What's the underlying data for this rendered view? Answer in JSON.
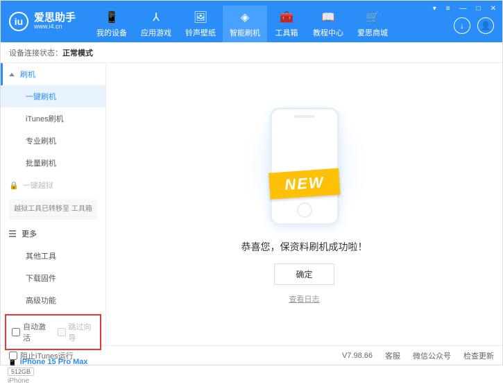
{
  "app": {
    "title": "爱思助手",
    "subtitle": "www.i4.cn"
  },
  "titlebar": {
    "t1": "▾",
    "t2": "≡",
    "t3": "—",
    "t4": "□",
    "t5": "✕"
  },
  "topnav": [
    {
      "label": "我的设备"
    },
    {
      "label": "应用游戏"
    },
    {
      "label": "铃声壁纸"
    },
    {
      "label": "智能刷机"
    },
    {
      "label": "工具箱"
    },
    {
      "label": "教程中心"
    },
    {
      "label": "爱思商城"
    }
  ],
  "status": {
    "prefix": "设备连接状态：",
    "value": "正常模式"
  },
  "sidebar": {
    "flash": {
      "header": "刷机",
      "items": [
        "一键刷机",
        "iTunes刷机",
        "专业刷机",
        "批量刷机"
      ]
    },
    "jailbreak": {
      "header": "一键越狱",
      "note": "越狱工具已转移至\n工具箱"
    },
    "more": {
      "header": "更多",
      "items": [
        "其他工具",
        "下载固件",
        "高级功能"
      ]
    },
    "checks": {
      "auto": "自动激活",
      "skip": "跳过向导"
    },
    "device": {
      "name": "iPhone 15 Pro Max",
      "storage": "512GB",
      "type": "iPhone"
    }
  },
  "main": {
    "ribbon": "NEW",
    "message": "恭喜您，保资料刷机成功啦！",
    "ok": "确定",
    "log": "查看日志"
  },
  "footer": {
    "block": "阻止iTunes运行",
    "version": "V7.98.66",
    "links": [
      "客服",
      "微信公众号",
      "检查更新"
    ]
  }
}
